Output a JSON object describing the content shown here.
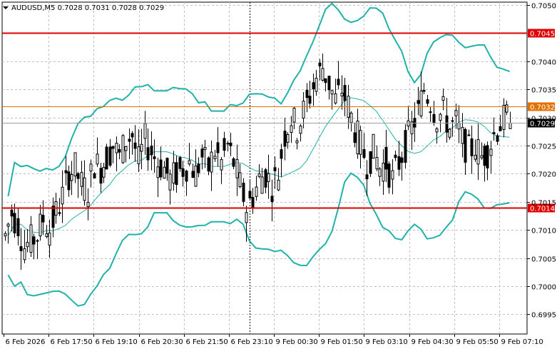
{
  "header": {
    "symbol_info": "AUDUSD,M5  0.7028 0.7031 0.7028 0.7029"
  },
  "chart_data": {
    "type": "candlestick",
    "symbol": "AUDUSD",
    "timeframe": "M5",
    "last_quote": {
      "open": 0.7028,
      "high": 0.7031,
      "low": 0.7028,
      "close": 0.7029
    },
    "y_ticks": [
      "0.7050",
      "0.7045",
      "0.7040",
      "0.7035",
      "0.7032",
      "0.7030",
      "0.7029",
      "0.7025",
      "0.7020",
      "0.7015",
      "0.7014",
      "0.7010",
      "0.7005",
      "0.7000",
      "0.6995"
    ],
    "y_tick_values": [
      0.705,
      0.704,
      0.7035,
      0.703,
      0.7025,
      0.702,
      0.7015,
      0.701,
      0.7005,
      0.7,
      0.6995
    ],
    "y_tick_labels": [
      "0.7050",
      "0.7040",
      "0.7035",
      "0.7030",
      "0.7025",
      "0.7020",
      "0.7015",
      "0.7010",
      "0.7005",
      "0.7000",
      "0.6995"
    ],
    "ylim": [
      0.69915,
      0.70505
    ],
    "x_tick_labels": [
      "6 Feb 2026",
      "6 Feb 17:50",
      "6 Feb 19:10",
      "6 Feb 20:30",
      "6 Feb 21:50",
      "6 Feb 23:10",
      "9 Feb 00:30",
      "9 Feb 01:50",
      "9 Feb 03:10",
      "9 Feb 04:30",
      "9 Feb 05:50",
      "9 Feb 07:10"
    ],
    "horizontal_levels": [
      {
        "value": 0.7045,
        "label": "0.7045",
        "color": "#e00000"
      },
      {
        "value": 0.7014,
        "label": "0.7014",
        "color": "#e00000"
      },
      {
        "value": 0.7032,
        "label": "0.7032",
        "color": "#e07000"
      }
    ],
    "current_price": {
      "value": 0.7029,
      "label": "0.7029"
    },
    "separator_after_x_label": "6 Feb 23:10",
    "colors": {
      "candle": "#000000",
      "bollinger": "#20b2aa",
      "moving_average": "#20b2aa",
      "resistance": "#e00000",
      "pivot": "#e07000",
      "grid": "#c0c0c0",
      "current_price_tag": "#000000"
    },
    "close_series": [
      0.7009,
      0.7013,
      0.7011,
      0.7007,
      0.7008,
      0.7009,
      0.7012,
      0.701,
      0.7013,
      0.7016,
      0.702,
      0.7021,
      0.7018,
      0.7017,
      0.7022,
      0.7021,
      0.7023,
      0.7025,
      0.7023,
      0.7026,
      0.7027,
      0.7022,
      0.7026,
      0.7024,
      0.7022,
      0.7021,
      0.7019,
      0.702,
      0.7021,
      0.7022,
      0.702,
      0.7023,
      0.7021,
      0.7024,
      0.7022,
      0.7025,
      0.7022,
      0.7018,
      0.7014,
      0.7016,
      0.7019,
      0.702,
      0.7018,
      0.702,
      0.7027,
      0.703,
      0.7028,
      0.7031,
      0.7034,
      0.7037,
      0.7039,
      0.7036,
      0.7033,
      0.7035,
      0.7032,
      0.7028,
      0.7025,
      0.7022,
      0.7024,
      0.7021,
      0.7022,
      0.7019,
      0.7022,
      0.7025,
      0.7028,
      0.7031,
      0.7035,
      0.7033,
      0.703,
      0.7031,
      0.7028,
      0.7029,
      0.7026,
      0.7024,
      0.7025,
      0.7023,
      0.7024,
      0.7027,
      0.7029,
      0.703
    ]
  }
}
